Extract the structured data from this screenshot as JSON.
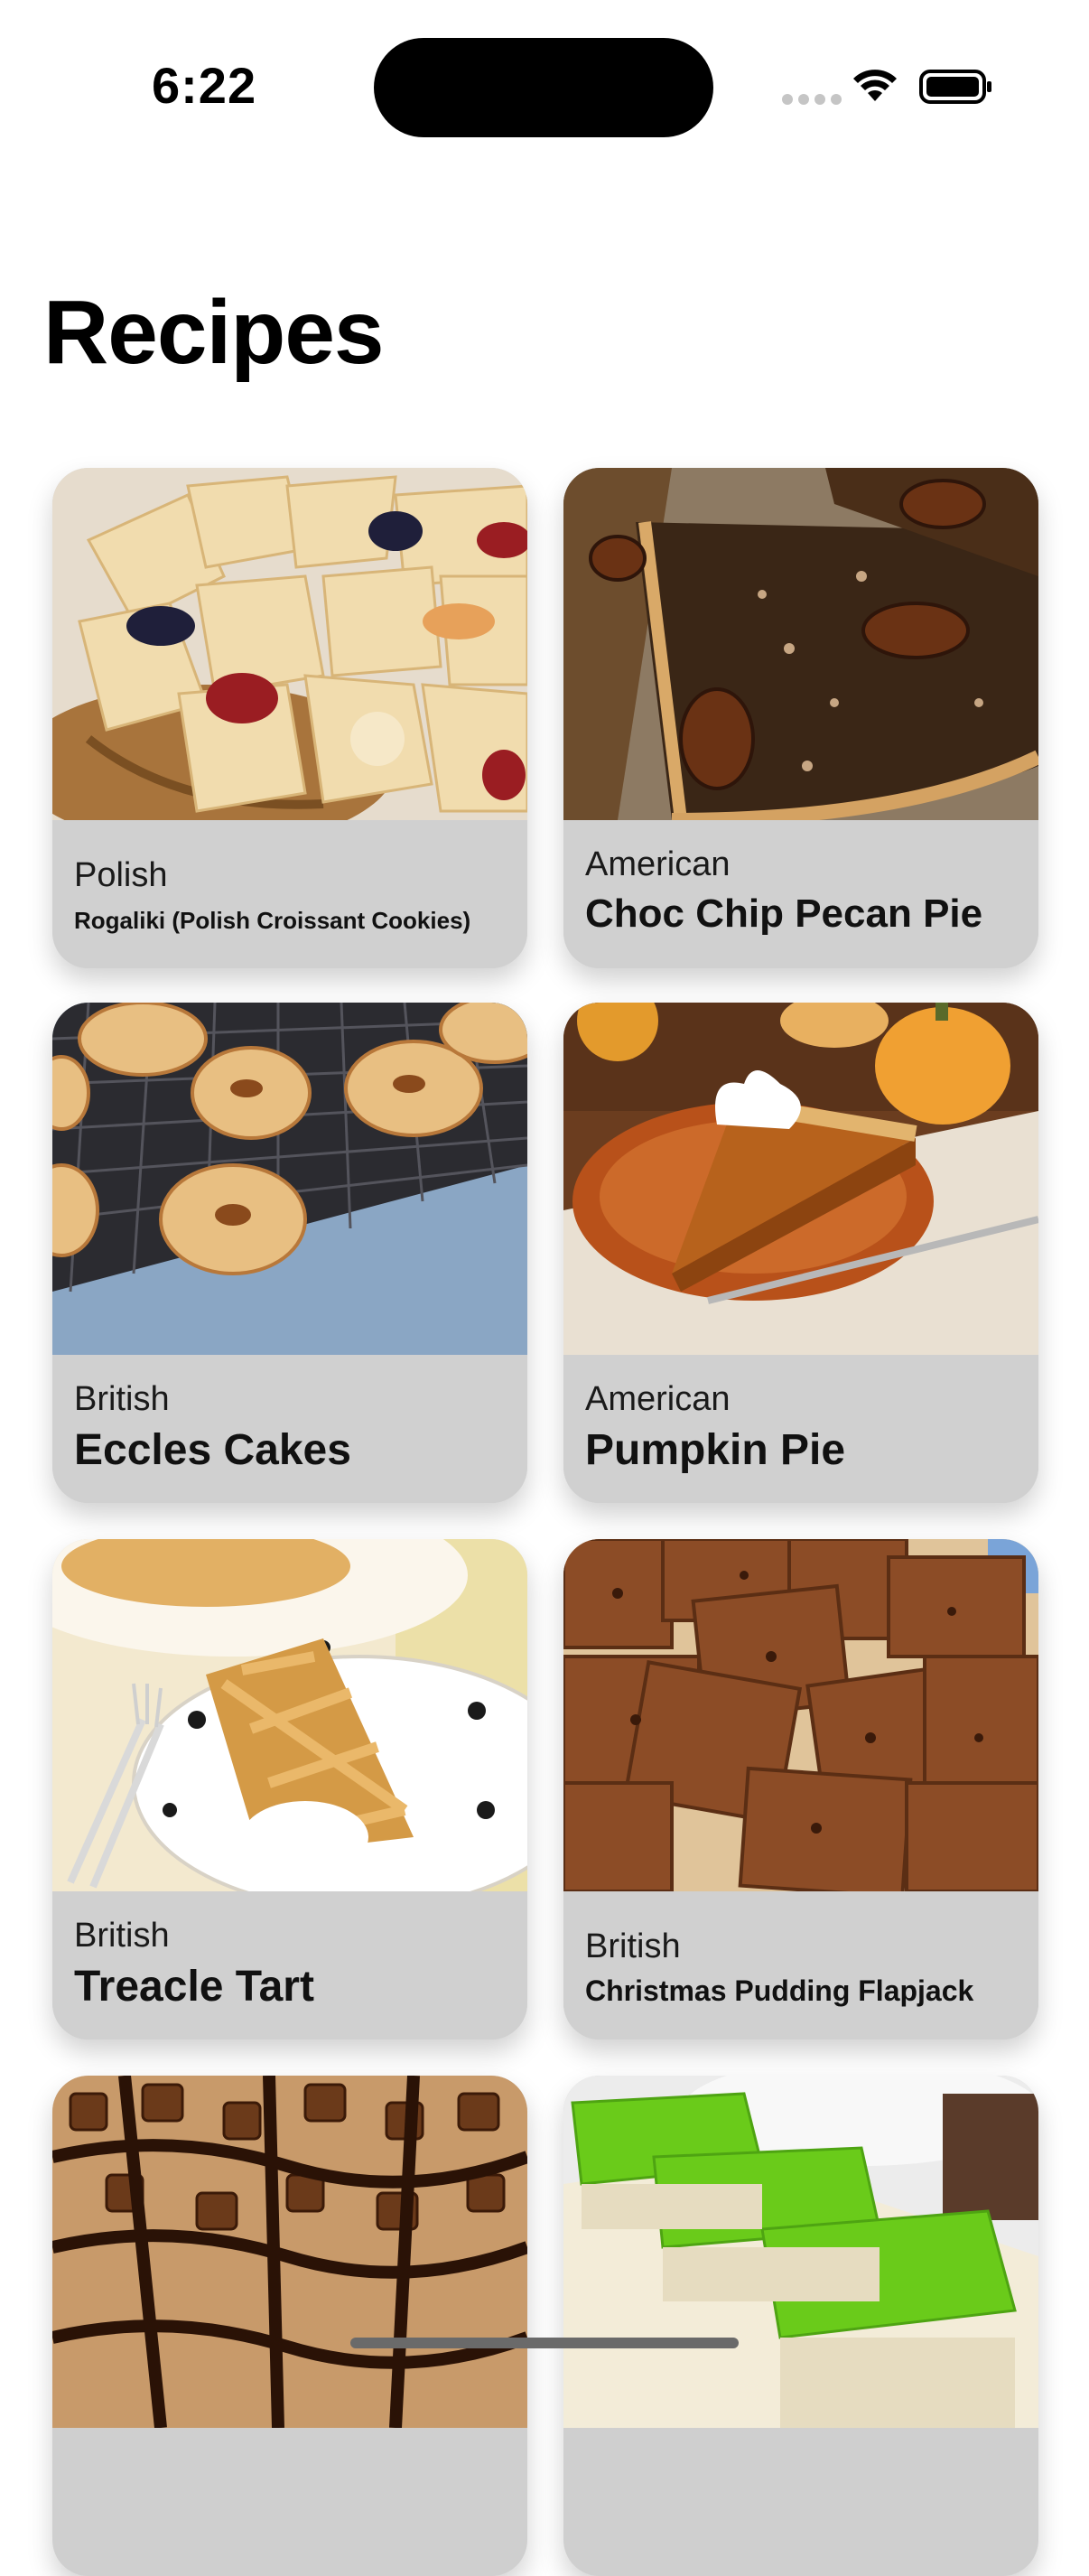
{
  "status_bar": {
    "time": "6:22"
  },
  "page": {
    "title": "Recipes"
  },
  "recipes": [
    {
      "area": "Polish",
      "name": "Rogaliki (Polish Croissant Cookies)",
      "image_icon": "cookies-photo"
    },
    {
      "area": "American",
      "name": "Choc Chip Pecan Pie",
      "image_icon": "pecan-pie-photo"
    },
    {
      "area": "British",
      "name": "Eccles Cakes",
      "image_icon": "eccles-cakes-photo"
    },
    {
      "area": "American",
      "name": "Pumpkin Pie",
      "image_icon": "pumpkin-pie-photo"
    },
    {
      "area": "British",
      "name": "Treacle Tart",
      "image_icon": "treacle-tart-photo"
    },
    {
      "area": "British",
      "name": "Christmas Pudding Flapjack",
      "image_icon": "flapjack-photo"
    },
    {
      "image_icon": "chocolate-pie-photo"
    },
    {
      "image_icon": "green-jelly-photo"
    }
  ],
  "colors": {
    "card_background": "#d0d0d0",
    "page_background": "#ffffff",
    "text": "#111111"
  }
}
